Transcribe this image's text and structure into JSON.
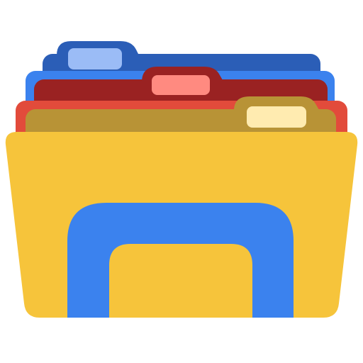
{
  "icon": {
    "name": "file-explorer-icon",
    "colors": {
      "back_folder_outer": "#2B5EB7",
      "back_folder_blue": "#3B82EE",
      "back_tab_light": "#9BBCF6",
      "middle_folder_dark": "#9A2222",
      "middle_folder_red": "#E24B3B",
      "middle_tab_light": "#FF8A80",
      "front_back_folder": "#B89336",
      "front_tab_light": "#FFEBB0",
      "main_folder": "#F6C43B",
      "arch_blue": "#3B82EE"
    }
  }
}
